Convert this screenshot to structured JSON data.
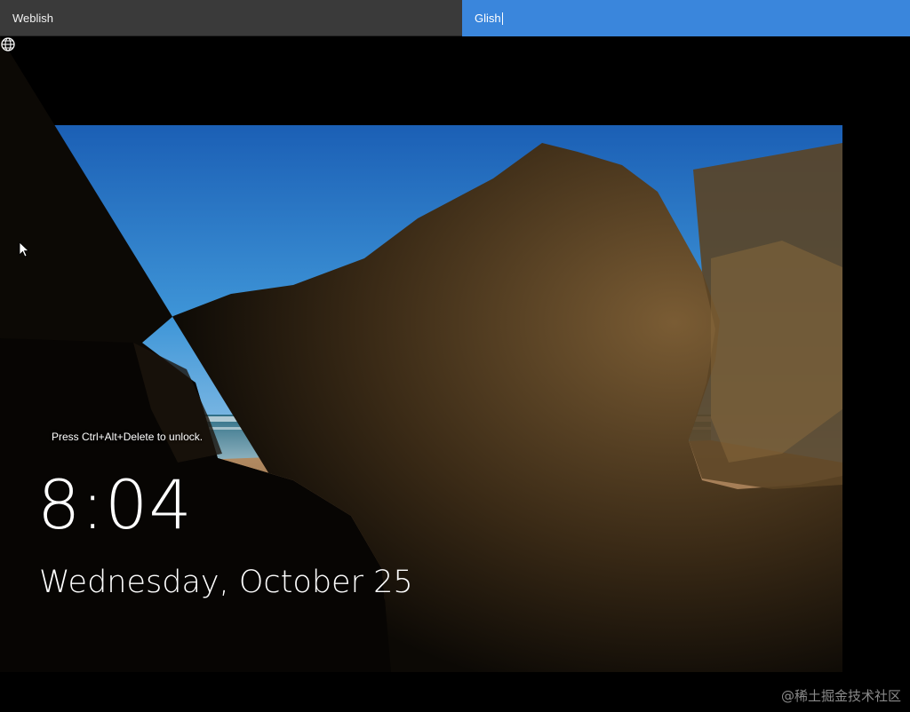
{
  "tabs": [
    {
      "label": "Weblish",
      "active": false
    },
    {
      "label": "Glish",
      "active": true
    }
  ],
  "lockscreen": {
    "hint": "Press Ctrl+Alt+Delete to unlock.",
    "time": "8:04",
    "date": "Wednesday, October 25"
  },
  "status_icons": [
    "network-globe-icon"
  ],
  "watermark": "@稀土掘金技术社区",
  "colors": {
    "active_tab": "#3a86dc",
    "inactive_tab": "#3a3a3a"
  }
}
